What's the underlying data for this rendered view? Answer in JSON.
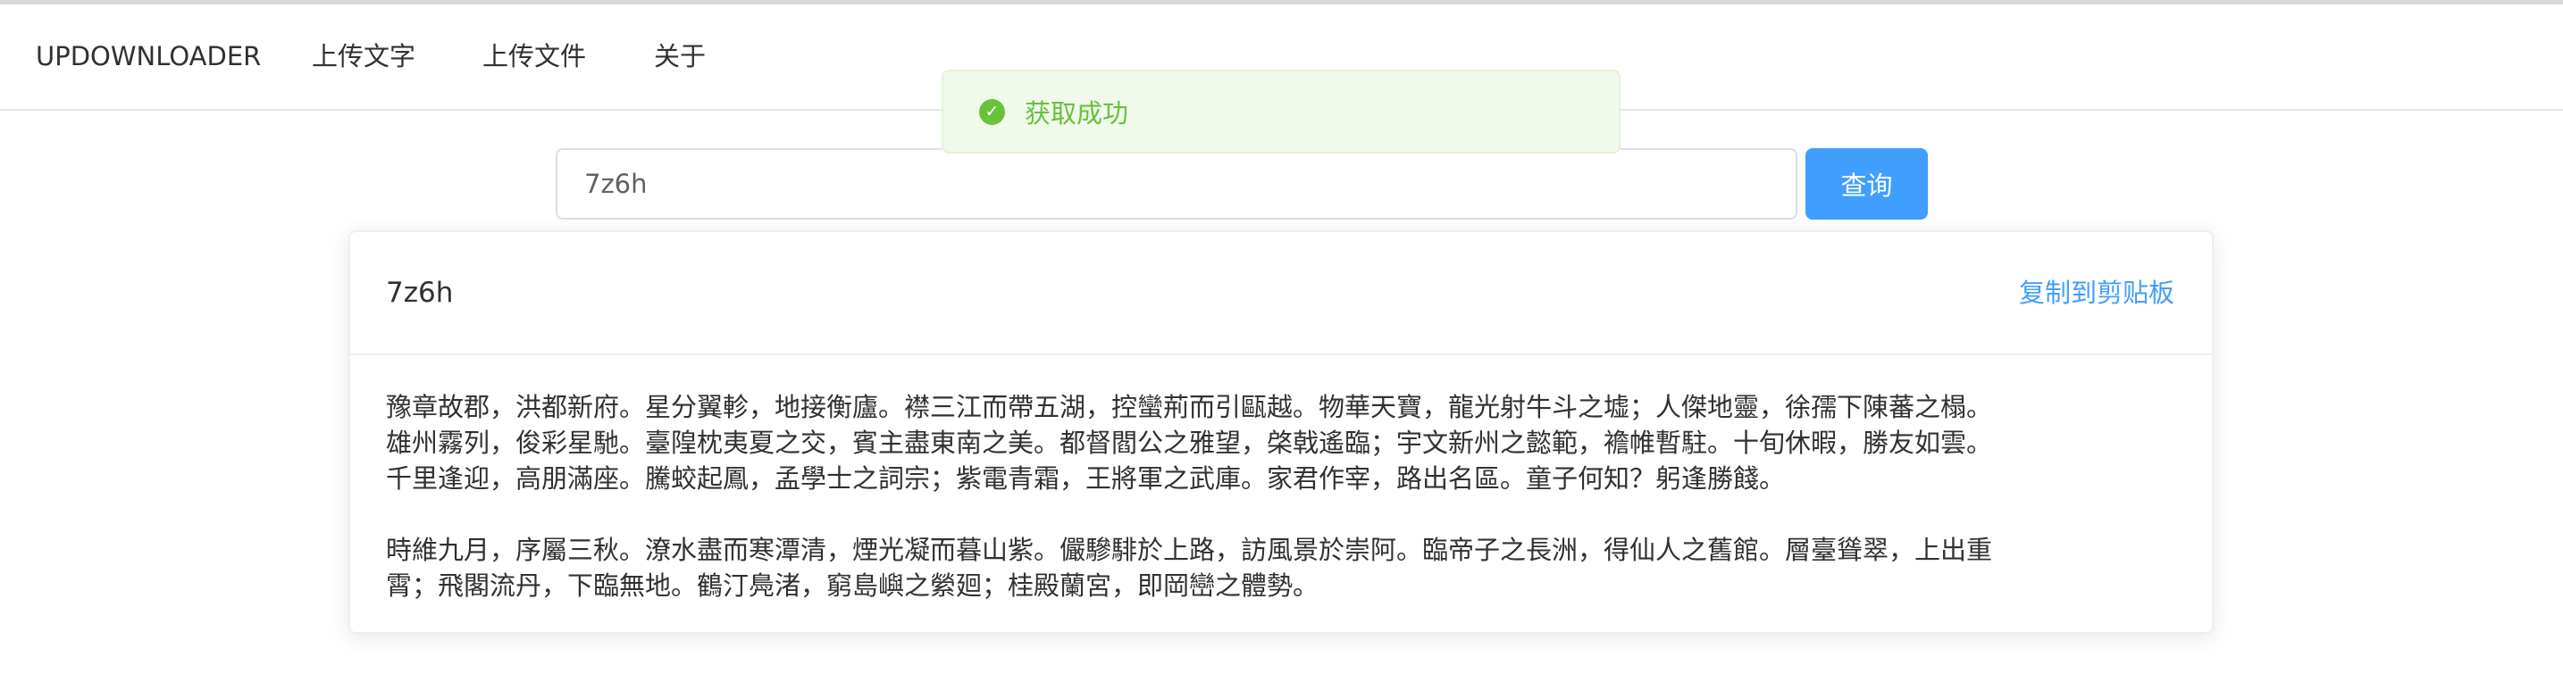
{
  "nav": {
    "brand": "UPDOWNLOADER",
    "items": [
      "上传文字",
      "上传文件",
      "关于"
    ]
  },
  "toast": {
    "icon": "check-circle-icon",
    "message": "获取成功",
    "color": "#67c23a"
  },
  "search": {
    "value": "7z6h",
    "button_label": "查询",
    "accent_color": "#409eff"
  },
  "result": {
    "title": "7z6h",
    "copy_label": "复制到剪贴板",
    "paragraphs": [
      "豫章故郡，洪都新府。星分翼軫，地接衡廬。襟三江而帶五湖，控蠻荊而引甌越。物華天寶，龍光射牛斗之墟；人傑地靈，徐孺下陳蕃之榻。\n雄州霧列，俊彩星馳。臺隍枕夷夏之交，賓主盡東南之美。都督閻公之雅望，棨戟遙臨；宇文新州之懿範，襜帷暫駐。十旬休暇，勝友如雲。\n千里逢迎，高朋滿座。騰蛟起鳳，孟學士之詞宗；紫電青霜，王將軍之武庫。家君作宰，路出名區。童子何知？躬逢勝餞。",
      "時維九月，序屬三秋。潦水盡而寒潭清，煙光凝而暮山紫。儼驂騑於上路，訪風景於崇阿。臨帝子之長洲，得仙人之舊館。層臺聳翠，上出重\n霄；飛閣流丹，下臨無地。鶴汀鳧渚，窮島嶼之縈廻；桂殿蘭宮，即岡巒之體勢。"
    ]
  }
}
